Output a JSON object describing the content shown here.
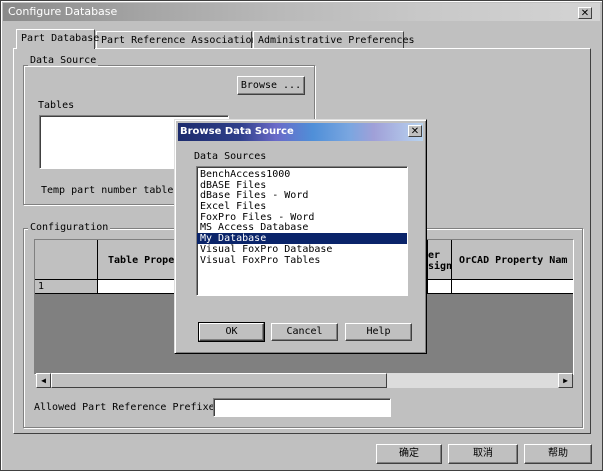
{
  "window": {
    "title": "Configure Database",
    "close": "✕"
  },
  "tabs": [
    {
      "label": "Part Database",
      "active": true
    },
    {
      "label": "Part Reference Associations",
      "active": false
    },
    {
      "label": "Administrative Preferences",
      "active": false
    }
  ],
  "data_source": {
    "group_label": "Data Source",
    "browse_label": "Browse ...",
    "tables_label": "Tables",
    "temp_label": "Temp part number table"
  },
  "configuration": {
    "group_label": "Configuration",
    "columns": [
      "Table Prope",
      "er\nsign",
      "OrCAD Property Nam"
    ],
    "rows": [
      {
        "num": "1"
      }
    ],
    "allowed_prefixes_label": "Allowed Part Reference Prefixes :",
    "allowed_prefixes_value": ""
  },
  "footer": {
    "ok": "确定",
    "cancel": "取消",
    "help": "帮助"
  },
  "dialog": {
    "title": "Browse Data Source",
    "close": "✕",
    "sources_label": "Data Sources",
    "sources": [
      {
        "label": "BenchAccess1000",
        "selected": false
      },
      {
        "label": "dBASE Files",
        "selected": false
      },
      {
        "label": "dBase Files - Word",
        "selected": false
      },
      {
        "label": "Excel Files",
        "selected": false
      },
      {
        "label": "FoxPro Files - Word",
        "selected": false
      },
      {
        "label": "MS Access Database",
        "selected": false
      },
      {
        "label": "My Database",
        "selected": true
      },
      {
        "label": "Visual FoxPro Database",
        "selected": false
      },
      {
        "label": "Visual FoxPro Tables",
        "selected": false
      }
    ],
    "ok": "OK",
    "cancel": "Cancel",
    "help": "Help"
  },
  "colors": {
    "selection": "#0a246a",
    "face": "#c0c0c0"
  }
}
